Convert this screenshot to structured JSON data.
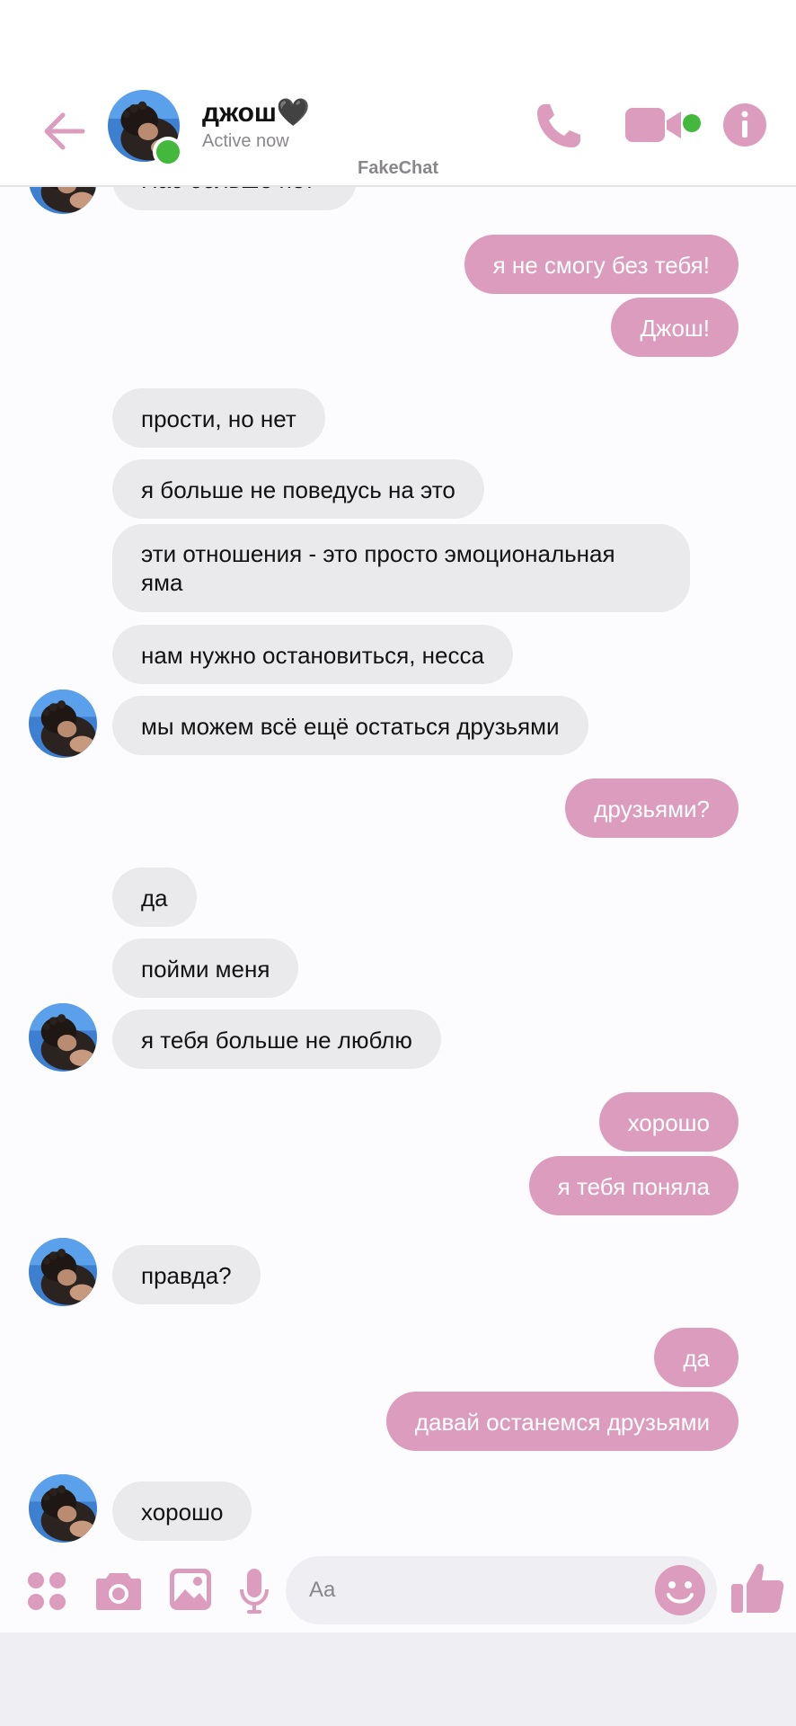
{
  "header": {
    "contact_name": "джош🖤",
    "status": "Active now",
    "watermark": "FakeChat"
  },
  "messages": [
    {
      "dir": "in",
      "text": "Нас больше нет"
    },
    {
      "dir": "out",
      "text": "я не смогу без тебя!"
    },
    {
      "dir": "out",
      "text": "Джош!"
    },
    {
      "dir": "in",
      "text": "прости, но нет"
    },
    {
      "dir": "in",
      "text": "я больше не поведусь на это"
    },
    {
      "dir": "in",
      "text": "эти отношения - это просто эмоциональная яма"
    },
    {
      "dir": "in",
      "text": "нам нужно остановиться, несса"
    },
    {
      "dir": "in",
      "text": "мы можем всё ещё остаться друзьями"
    },
    {
      "dir": "out",
      "text": "друзьями?"
    },
    {
      "dir": "in",
      "text": "да"
    },
    {
      "dir": "in",
      "text": "пойми меня"
    },
    {
      "dir": "in",
      "text": "я тебя больше не люблю"
    },
    {
      "dir": "out",
      "text": "хорошо"
    },
    {
      "dir": "out",
      "text": "я тебя поняла"
    },
    {
      "dir": "in",
      "text": "правда?"
    },
    {
      "dir": "out",
      "text": "да"
    },
    {
      "dir": "out",
      "text": "давай останемся друзьями"
    },
    {
      "dir": "in",
      "text": "хорошо"
    }
  ],
  "composer": {
    "placeholder": "Aa",
    "icons": [
      "apps-icon",
      "camera-icon",
      "gallery-icon",
      "microphone-icon",
      "emoji-icon",
      "thumbs-up-icon"
    ]
  },
  "colors": {
    "accent": "#dc9cbd",
    "incoming_bubble": "#eae9ec",
    "online": "#43b83c"
  }
}
